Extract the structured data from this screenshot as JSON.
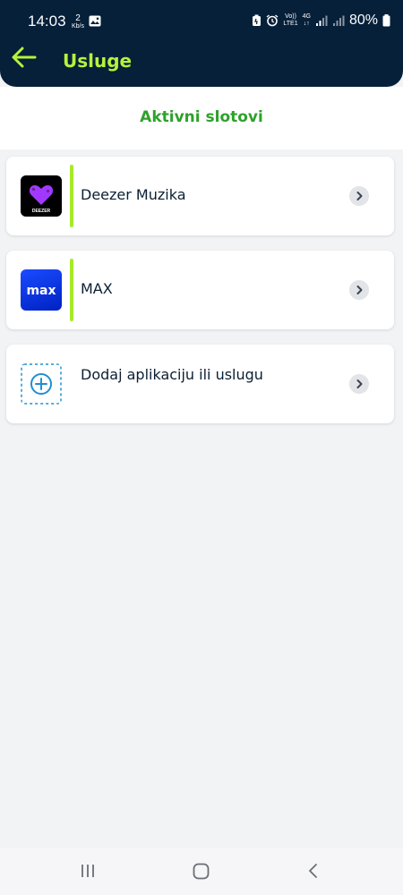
{
  "status_bar": {
    "time": "14:03",
    "net_speed_value": "2",
    "net_speed_unit": "Kb/s",
    "volte_label": "Vo))",
    "lte_label": "LTE1",
    "net_type": "4G",
    "battery_text": "80%"
  },
  "header": {
    "title": "Usluge"
  },
  "section": {
    "title": "Aktivni slotovi"
  },
  "items": [
    {
      "label": "Deezer Muzika",
      "logo_text": "DEEZER",
      "icon": "deezer-logo",
      "has_accent": true
    },
    {
      "label": "MAX",
      "logo_text": "max",
      "icon": "max-logo",
      "has_accent": true
    },
    {
      "label": "Dodaj aplikaciju ili uslugu",
      "icon": "add-circle-icon",
      "has_accent": false
    }
  ],
  "colors": {
    "header_bg": "#06203a",
    "accent_green": "#b6f23b",
    "section_title": "#2ea12b",
    "slot_bar": "#a8ea2a",
    "add_icon_blue": "#1f8fd1"
  }
}
